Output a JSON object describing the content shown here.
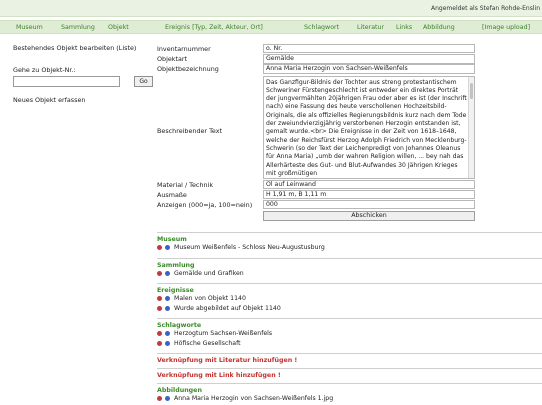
{
  "topbar": {
    "login_text": "Angemeldet als Stefan Rohde-Enslin"
  },
  "nav": {
    "museum": "Museum",
    "sammlung": "Sammlung",
    "objekt": "Objekt",
    "ereignis": "Ereignis [Typ, Zeit, Akteur, Ort]",
    "schlagwort": "Schlagwort",
    "literatur": "Literatur",
    "links": "Links",
    "abbildung": "Abbildung",
    "image_upload": "[Image upload]"
  },
  "sidebar": {
    "edit_link": "Bestehendes Objekt bearbeiten (Liste)",
    "goto_label": "Gehe zu Objekt-Nr.:",
    "goto_value": "",
    "goto_button": "Go",
    "new_link": "Neues Objekt erfassen"
  },
  "form": {
    "inventarnummer_label": "Inventarnummer",
    "inventarnummer_value": "o. Nr.",
    "objektart_label": "Objektart",
    "objektart_value": "Gemälde",
    "objektbezeichnung_label": "Objektbezeichnung",
    "objektbezeichnung_value": "Anna Maria Herzogin von Sachsen-Weißenfels",
    "beschreibung_label": "Beschreibender Text",
    "beschreibung_value": "Das Ganzfigur-Bildnis der Tochter aus streng protestantischem Schweriner Fürstengeschlecht ist entweder ein direktes Porträt der jungvermählten 20jährigen Frau oder aber es ist (der Inschrift nach) eine Fassung des heute verschollenen Hochzeitsbild-Originals, die als offizielles Regierungsbildnis kurz nach dem Tode der zweiundvierzigjährig verstorbenen Herzogin entstanden ist, gemalt wurde.<br> Die Ereignisse in der Zeit von 1618–1648, welche der Reichsfürst Herzog Adolph Friedrich von Mecklenburg-Schwerin (so der Text der Leichenpredigt von Johannes Oleanus für Anna Maria) „umb der wahren Religion willen, ... bey nah das Allerhärteste des Gut- und Blut-Aufwandes 30 Jährigen Krieges mit großmütigen",
    "material_label": "Material / Technik",
    "material_value": "Öl auf Leinwand",
    "masse_label": "Ausmaße",
    "masse_value": "H 1,91 m, B 1,11 m",
    "anzeigen_label": "Anzeigen (000=ja, 100=nein)",
    "anzeigen_value": "000",
    "submit_label": "Abschicken"
  },
  "sections": {
    "museum_title": "Museum",
    "museum_item": "Museum Weißenfels - Schloss Neu-Augustusburg",
    "sammlung_title": "Sammlung",
    "sammlung_item": "Gemälde und Grafiken",
    "ereignisse_title": "Ereignisse",
    "ereignis_item_1": "Malen von Objekt 1140",
    "ereignis_item_2": "Wurde abgebildet auf Objekt 1140",
    "schlagworte_title": "Schlagworte",
    "schlagwort_item_1": "Herzogtum Sachsen-Weißenfels",
    "schlagwort_item_2": "Höfische Gesellschaft",
    "literatur_link": "Verknüpfung mit Literatur hinzufügen !",
    "link_link": "Verknüpfung mit Link hinzufügen !",
    "abbildungen_title": "Abbildungen",
    "abbildung_item": "Anna Maria Herzogin von Sachsen-Weißenfels 1.jpg"
  },
  "colors": {
    "nav_text": "#3f7f2e",
    "nav_bg": "#dfedd4",
    "section_title": "#3b8a2a",
    "link_red": "#c0322f"
  },
  "icons": [
    "delete-icon",
    "edit-icon"
  ]
}
